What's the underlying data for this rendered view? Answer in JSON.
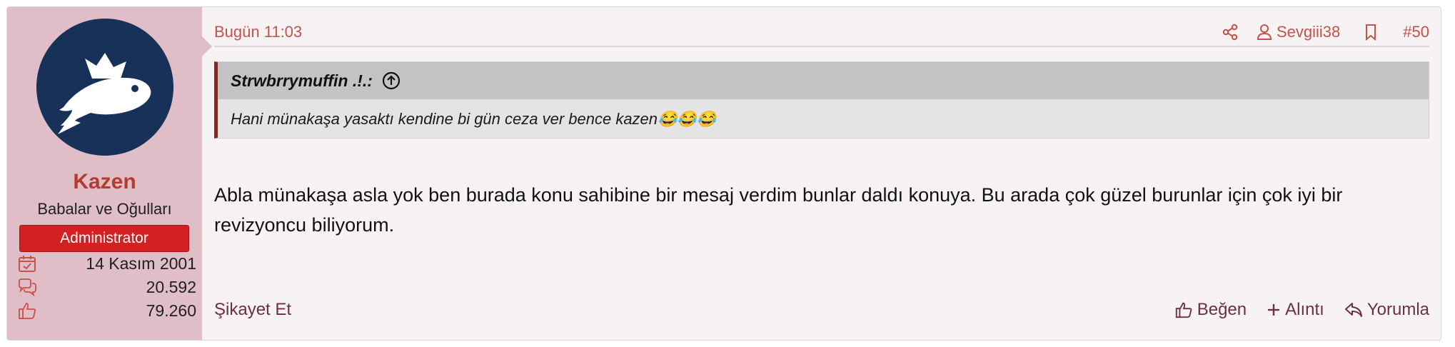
{
  "user": {
    "name": "Kazen",
    "title": "Babalar ve Oğulları",
    "role": "Administrator",
    "joined": "14 Kasım 2001",
    "messages": "20.592",
    "reactions": "79.260"
  },
  "post": {
    "timestamp": "Bugün 11:03",
    "mention": "Sevgiii38",
    "number": "#50",
    "quote": {
      "author": "Strwbrrymuffin .!.:",
      "text": "Hani münakaşa yasaktı kendine bi gün ceza ver bence kazen😂😂😂"
    },
    "content": "Abla münakaşa asla yok ben burada konu sahibine bir mesaj verdim bunlar daldı konuya. Bu arada çok güzel burunlar için çok iyi bir revizyoncu biliyorum."
  },
  "footer": {
    "report": "Şikayet Et",
    "like": "Beğen",
    "quote": "Alıntı",
    "reply": "Yorumla"
  },
  "colors": {
    "sidebar_bg": "#e0bec8",
    "accent": "#c65248",
    "role_badge": "#d32020",
    "quote_border": "#7b2b23",
    "footer_link": "#6f2f3f",
    "avatar_bg": "#183158"
  },
  "icons": {
    "joined": "calendar-check-icon",
    "messages": "speech-bubbles-icon",
    "reactions": "thumbs-up-icon",
    "share": "share-icon",
    "mention": "user-icon",
    "bookmark": "bookmark-icon",
    "quote_jump": "arrow-up-circle-icon",
    "like": "thumbs-up-icon",
    "quote": "plus-icon",
    "reply": "reply-icon"
  }
}
